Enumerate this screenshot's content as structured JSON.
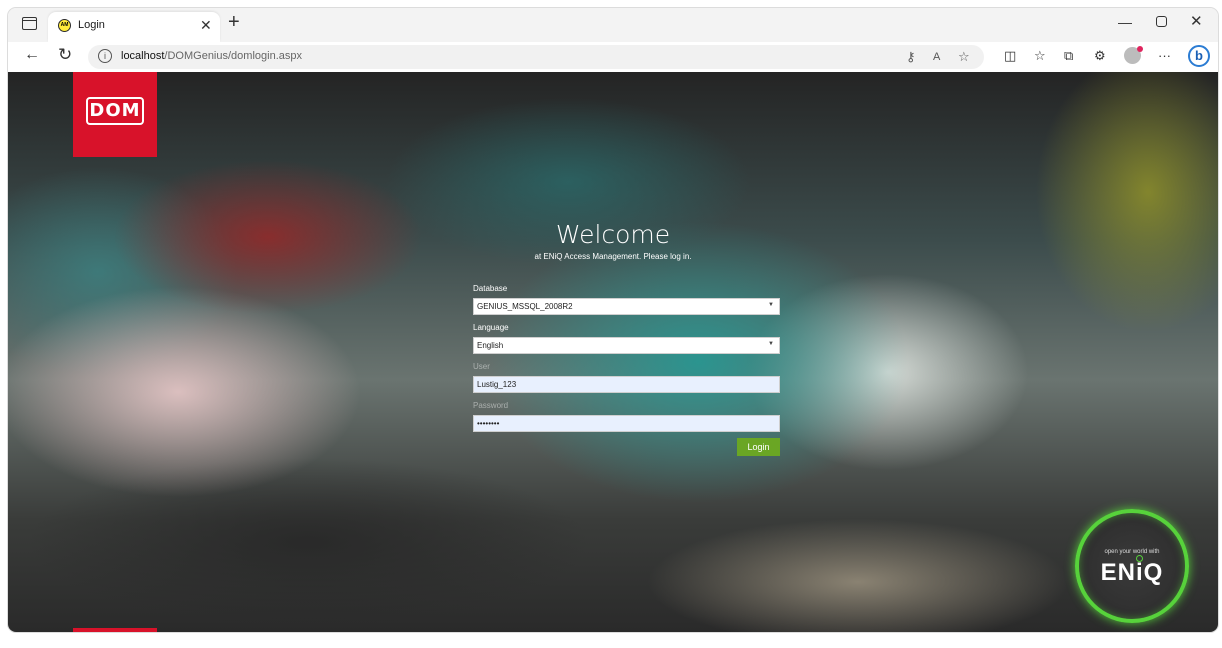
{
  "browser": {
    "tab_title": "Login",
    "tab_favicon_text": "AM",
    "new_tab_glyph": "+",
    "url_host": "localhost",
    "url_path": "/DOMGenius/domlogin.aspx"
  },
  "page": {
    "logo_text": "DOM",
    "welcome_title": "Welcome",
    "welcome_subtitle": "at ENiQ Access Management. Please log in.",
    "form": {
      "database_label": "Database",
      "database_value": "GENIUS_MSSQL_2008R2",
      "language_label": "Language",
      "language_value": "English",
      "user_label": "User",
      "user_value": "Lustig_123",
      "password_label": "Password",
      "password_value": "••••••••",
      "login_button": "Login"
    },
    "badge": {
      "tagline": "open your world with",
      "brand": "ENiQ"
    }
  },
  "colors": {
    "dom_red": "#d8122a",
    "login_green": "#6aa624",
    "eniq_green": "#57d23b"
  }
}
